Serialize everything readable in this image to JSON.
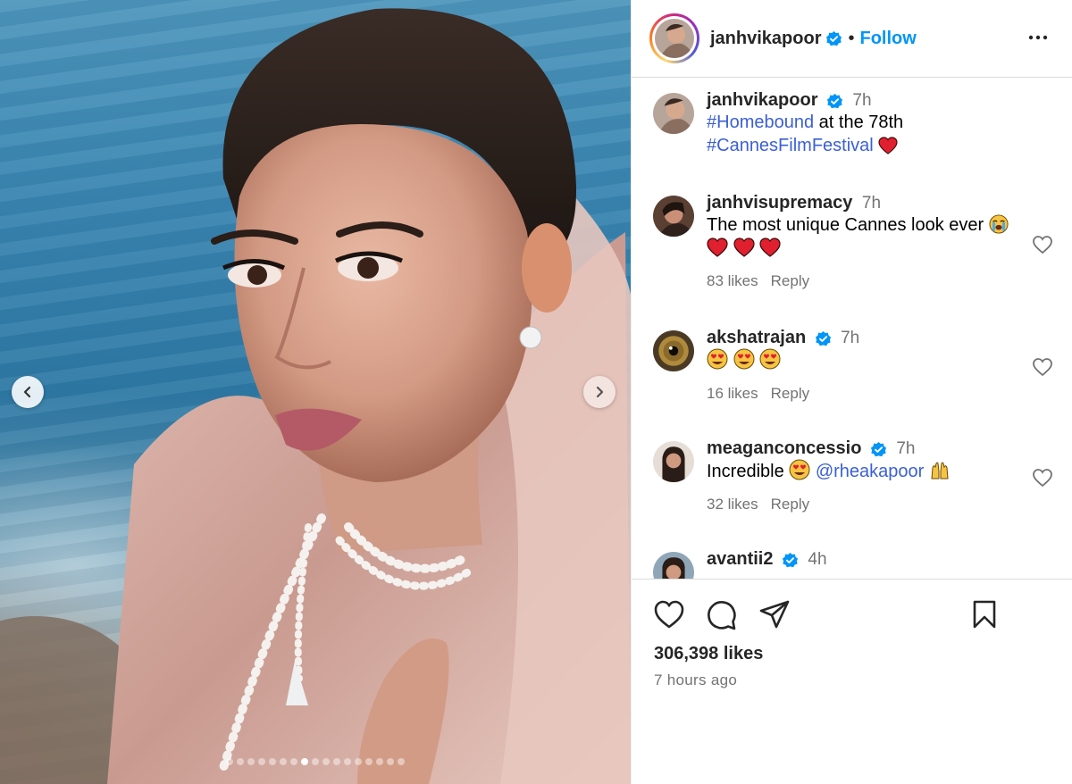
{
  "media": {
    "image_alt": "Photo of woman in pink dupatta by the sea",
    "slide_count": 17,
    "active_slide": 7,
    "icons": {
      "prev": "chevron-left-icon",
      "next": "chevron-right-icon"
    }
  },
  "header": {
    "username": "janhvikapoor",
    "verified": true,
    "separator": "•",
    "follow_label": "Follow",
    "more_icon": "more-horizontal-icon"
  },
  "caption": {
    "username": "janhvikapoor",
    "time": "7h",
    "hashtag1": "#Homebound",
    "text1": " at the 78th",
    "hashtag2": "#CannesFilmFestival",
    "emoji": "❤️"
  },
  "comments": [
    {
      "username": "janhvisupremacy",
      "time": "7h",
      "text": "The most unique Cannes look ever",
      "emoji_line": "❤️❤️❤️",
      "likes": "83 likes",
      "reply": "Reply"
    },
    {
      "username": "akshatrajan",
      "time": "7h",
      "text": "",
      "emoji_line": "😍😍😍",
      "likes": "16 likes",
      "reply": "Reply"
    },
    {
      "username": "meaganconcessio",
      "time": "7h",
      "text": "Incredible",
      "mention": "@rheakapoor",
      "likes": "32 likes",
      "reply": "Reply"
    },
    {
      "username": "avantii2",
      "time": "4h"
    }
  ],
  "footer": {
    "likes": "306,398 likes",
    "time_ago": "7 hours ago",
    "icons": [
      "heart-icon",
      "comment-icon",
      "share-icon",
      "bookmark-icon"
    ]
  },
  "colors": {
    "accent": "#0095f6",
    "hashtag": "#3b5fd6",
    "muted": "#737373",
    "verified": "#0095f6"
  }
}
